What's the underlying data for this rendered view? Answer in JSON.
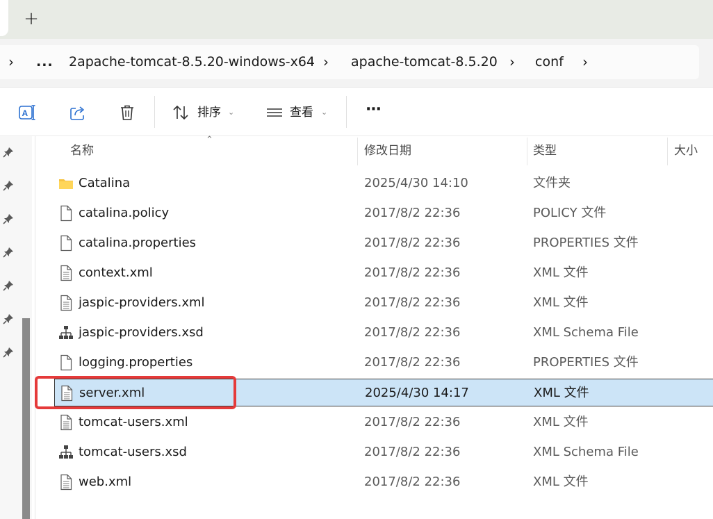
{
  "tabstrip": {
    "new_tab_label": "+"
  },
  "addressbar": {
    "overflow": "...",
    "crumbs": [
      "2apache-tomcat-8.5.20-windows-x64",
      "apache-tomcat-8.5.20",
      "conf"
    ]
  },
  "commandbar": {
    "icons": [
      "rename-icon",
      "share-icon",
      "delete-icon"
    ],
    "sort_label": "排序",
    "view_label": "查看",
    "more_label": "···"
  },
  "columns": {
    "name": "名称",
    "date": "修改日期",
    "type": "类型",
    "size": "大小"
  },
  "files": [
    {
      "name": "Catalina",
      "date": "2025/4/30 14:10",
      "type": "文件夹",
      "icon": "folder-icon"
    },
    {
      "name": "catalina.policy",
      "date": "2017/8/2 22:36",
      "type": "POLICY 文件",
      "icon": "file-icon"
    },
    {
      "name": "catalina.properties",
      "date": "2017/8/2 22:36",
      "type": "PROPERTIES 文件",
      "icon": "file-icon"
    },
    {
      "name": "context.xml",
      "date": "2017/8/2 22:36",
      "type": "XML 文件",
      "icon": "xml-file-icon"
    },
    {
      "name": "jaspic-providers.xml",
      "date": "2017/8/2 22:36",
      "type": "XML 文件",
      "icon": "xml-file-icon"
    },
    {
      "name": "jaspic-providers.xsd",
      "date": "2017/8/2 22:36",
      "type": "XML Schema File",
      "icon": "schema-file-icon"
    },
    {
      "name": "logging.properties",
      "date": "2017/8/2 22:36",
      "type": "PROPERTIES 文件",
      "icon": "file-icon"
    },
    {
      "name": "server.xml",
      "date": "2025/4/30 14:17",
      "type": "XML 文件",
      "icon": "xml-file-icon",
      "selected": true
    },
    {
      "name": "tomcat-users.xml",
      "date": "2017/8/2 22:36",
      "type": "XML 文件",
      "icon": "xml-file-icon"
    },
    {
      "name": "tomcat-users.xsd",
      "date": "2017/8/2 22:36",
      "type": "XML Schema File",
      "icon": "schema-file-icon"
    },
    {
      "name": "web.xml",
      "date": "2017/8/2 22:36",
      "type": "XML 文件",
      "icon": "xml-file-icon"
    }
  ],
  "colors": {
    "selection": "#cce4f7",
    "highlight": "#e53a3a"
  }
}
